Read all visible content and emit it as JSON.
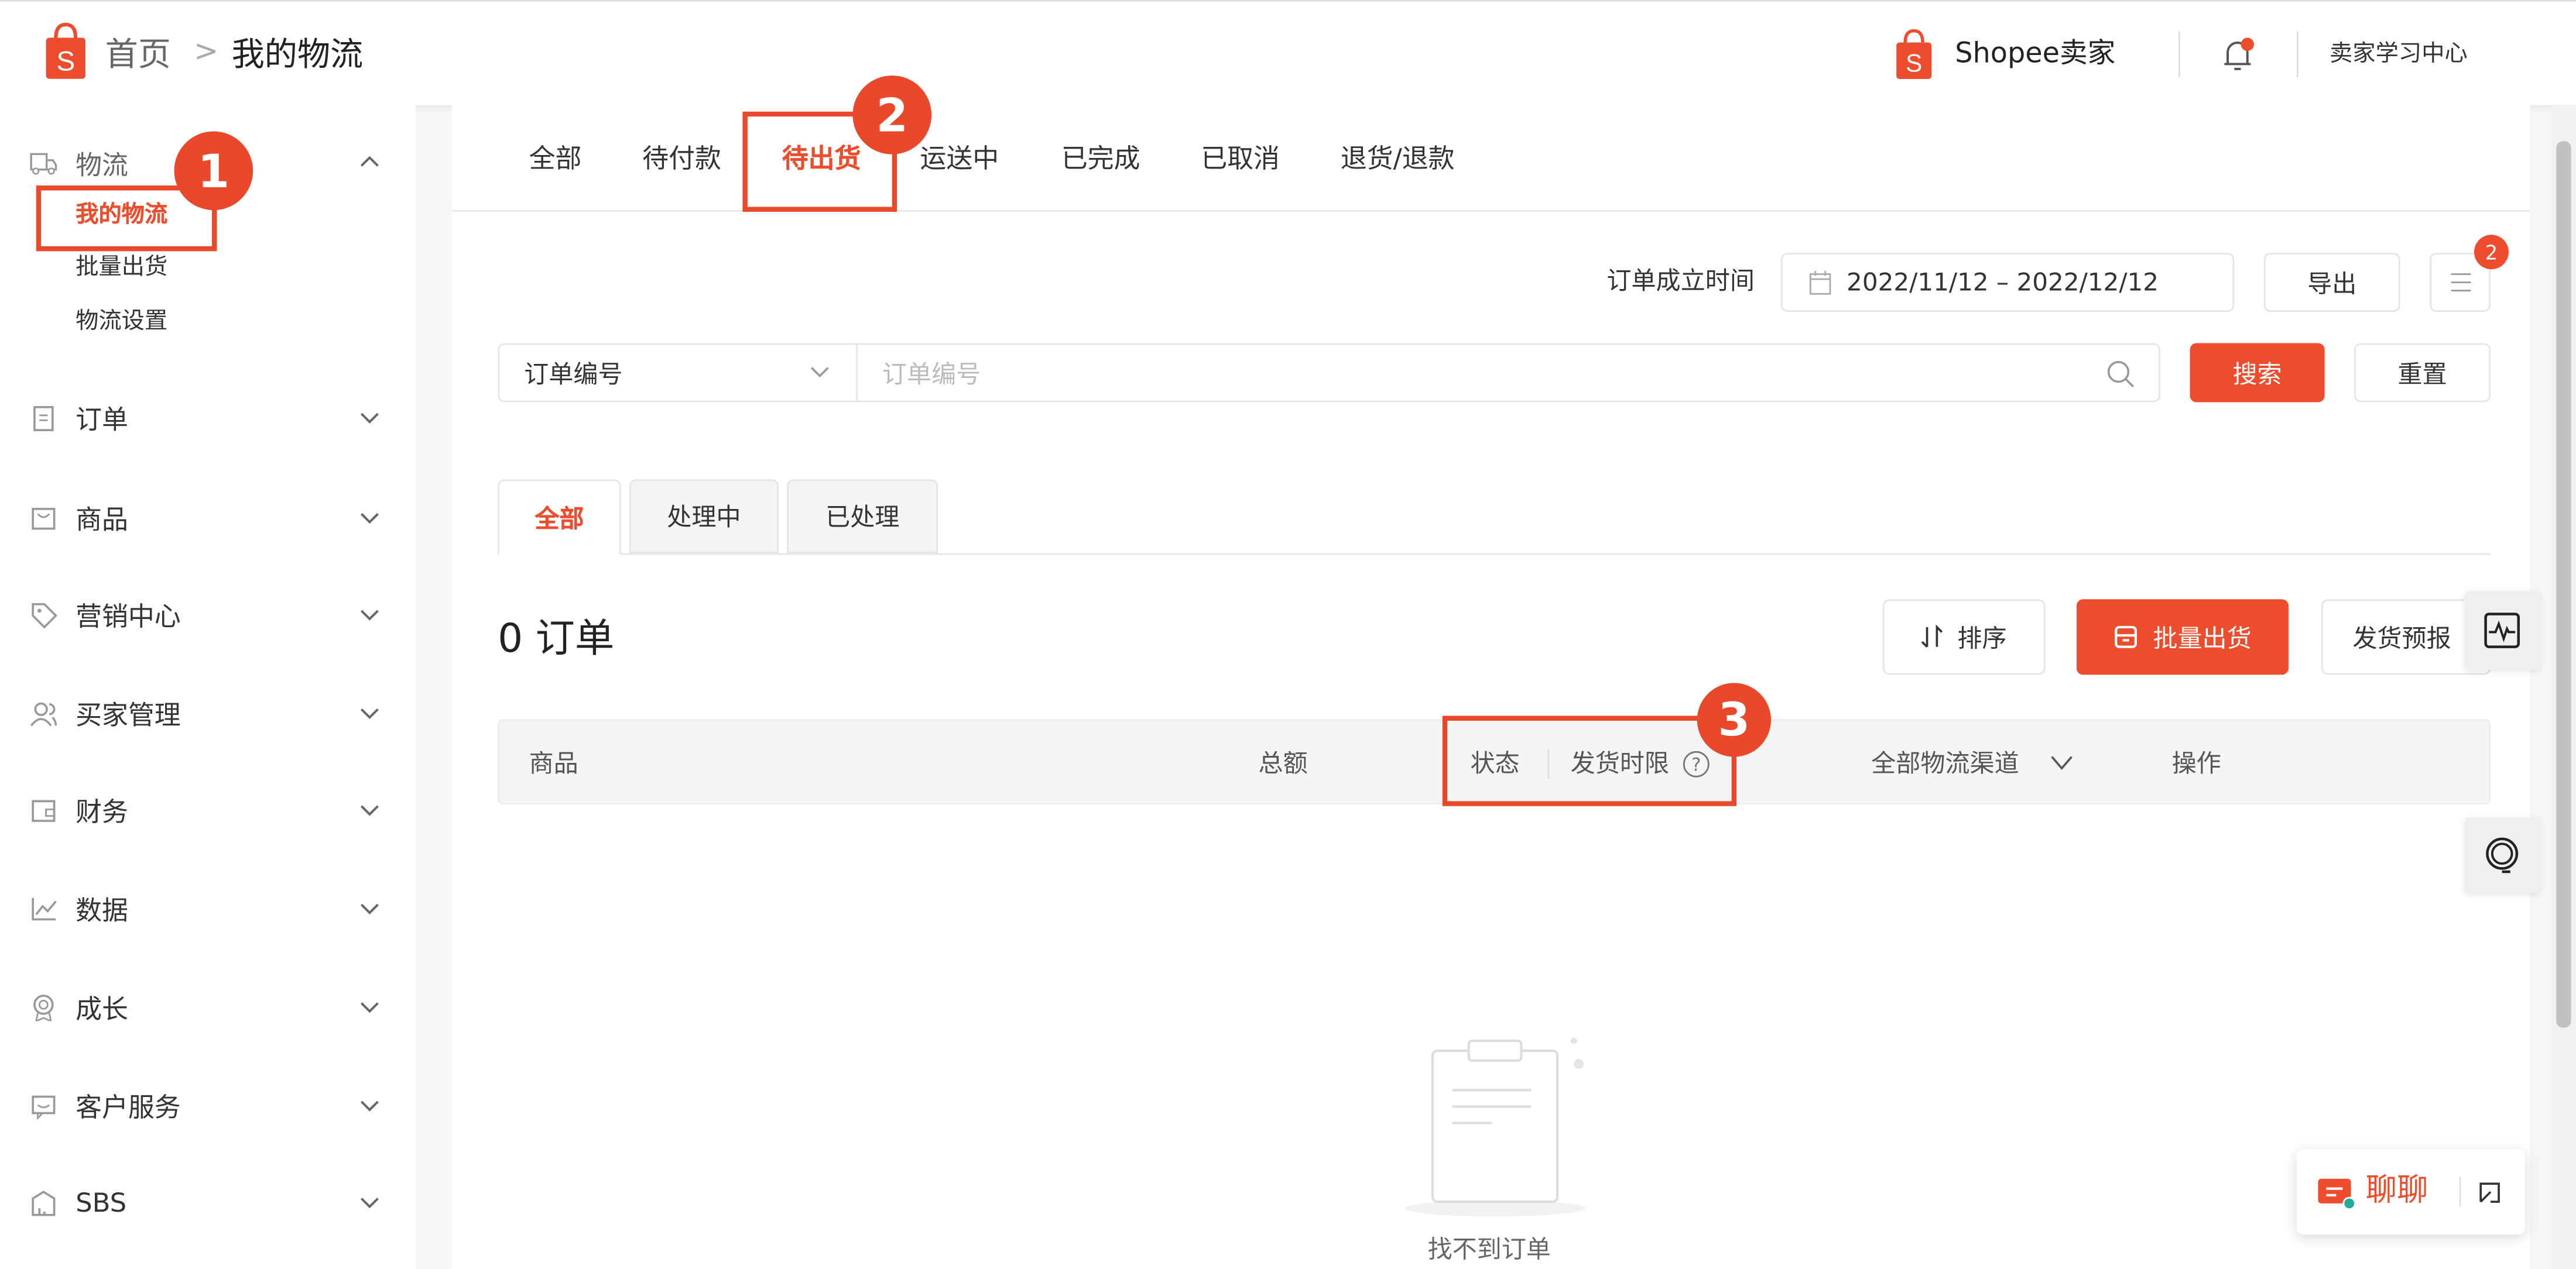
{
  "header": {
    "breadcrumb_home": "首页",
    "breadcrumb_sep": ">",
    "breadcrumb_current": "我的物流",
    "brand": "Shopee卖家",
    "learning_center": "卖家学习中心"
  },
  "sidebar": {
    "expanded": {
      "label": "物流",
      "children": [
        "我的物流",
        "批量出货",
        "物流设置"
      ],
      "active": "我的物流"
    },
    "items": [
      {
        "label": "订单",
        "icon": "clipboard-icon"
      },
      {
        "label": "商品",
        "icon": "bag-icon"
      },
      {
        "label": "营销中心",
        "icon": "tag-icon"
      },
      {
        "label": "买家管理",
        "icon": "users-icon"
      },
      {
        "label": "财务",
        "icon": "wallet-icon"
      },
      {
        "label": "数据",
        "icon": "chart-icon"
      },
      {
        "label": "成长",
        "icon": "medal-icon"
      },
      {
        "label": "客户服务",
        "icon": "message-icon"
      },
      {
        "label": "SBS",
        "icon": "warehouse-icon"
      }
    ]
  },
  "tabs": [
    "全部",
    "待付款",
    "待出货",
    "运送中",
    "已完成",
    "已取消",
    "退货/退款"
  ],
  "active_tab": "待出货",
  "filters": {
    "date_label": "订单成立时间",
    "date_range": "2022/11/12 – 2022/12/12",
    "export": "导出",
    "menu_badge": "2",
    "select_value": "订单编号",
    "search_placeholder": "订单编号",
    "search": "搜索",
    "reset": "重置"
  },
  "subtabs": [
    "全部",
    "处理中",
    "已处理"
  ],
  "orders": {
    "count_label": "0 订单",
    "sort": "排序",
    "bulk_ship": "批量出货",
    "ship_forecast": "发货预报"
  },
  "table_headers": {
    "product": "商品",
    "total": "总额",
    "status": "状态",
    "deadline": "发货时限",
    "channel": "全部物流渠道",
    "action": "操作"
  },
  "empty_text": "找不到订单",
  "chat": {
    "label": "聊聊"
  },
  "annotations": [
    "1",
    "2",
    "3"
  ],
  "colors": {
    "accent": "#ee4d2d",
    "annotation": "#e9482a"
  }
}
